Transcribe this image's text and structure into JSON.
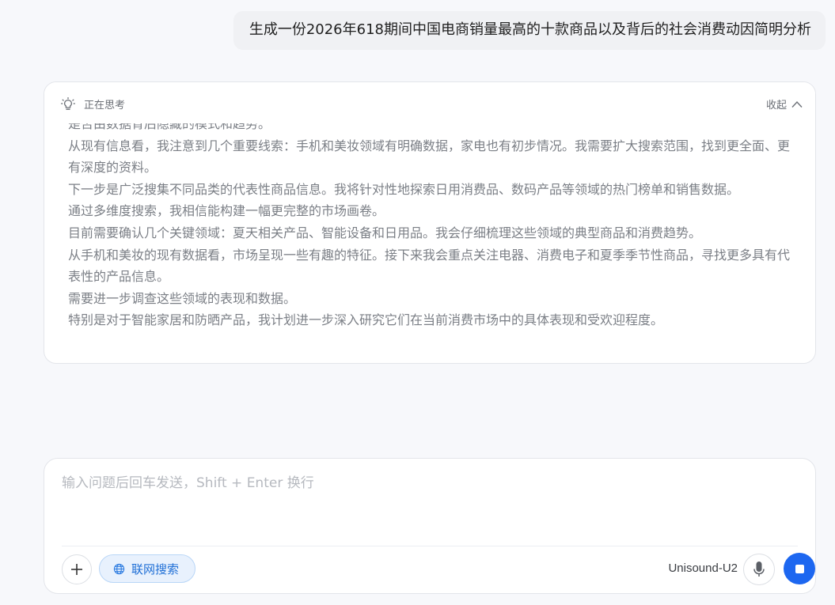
{
  "user_message": "生成一份2026年618期间中国电商销量最高的十款商品以及背后的社会消费动因简明分析",
  "thinking": {
    "status": "正在思考",
    "collapse_label": "收起",
    "lines": [
      "是否由数据背后隐藏的模式和趋势。",
      "从现有信息看，我注意到几个重要线索：手机和美妆领域有明确数据，家电也有初步情况。我需要扩大搜索范围，找到更全面、更有深度的资料。",
      "下一步是广泛搜集不同品类的代表性商品信息。我将针对性地探索日用消费品、数码产品等领域的热门榜单和销售数据。",
      "通过多维度搜索，我相信能构建一幅更完整的市场画卷。",
      "目前需要确认几个关键领域：夏天相关产品、智能设备和日用品。我会仔细梳理这些领域的典型商品和消费趋势。",
      "从手机和美妆的现有数据看，市场呈现一些有趣的特征。接下来我会重点关注电器、消费电子和夏季季节性商品，寻找更多具有代表性的产品信息。",
      "需要进一步调查这些领域的表现和数据。",
      "特别是对于智能家居和防晒产品，我计划进一步深入研究它们在当前消费市场中的具体表现和受欢迎程度。"
    ]
  },
  "composer": {
    "placeholder": "输入问题后回车发送，Shift + Enter 换行",
    "web_search_label": "联网搜索",
    "model_name": "Unisound-U2"
  },
  "colors": {
    "accent": "#1d67f0",
    "web_search_bg": "#e8f1fd",
    "web_search_text": "#1f6fd6"
  },
  "icons": {
    "thinking": "lightbulb-icon",
    "collapse": "chevron-up-icon",
    "add": "plus-icon",
    "web": "globe-icon",
    "mic": "microphone-icon",
    "stop": "stop-icon"
  }
}
